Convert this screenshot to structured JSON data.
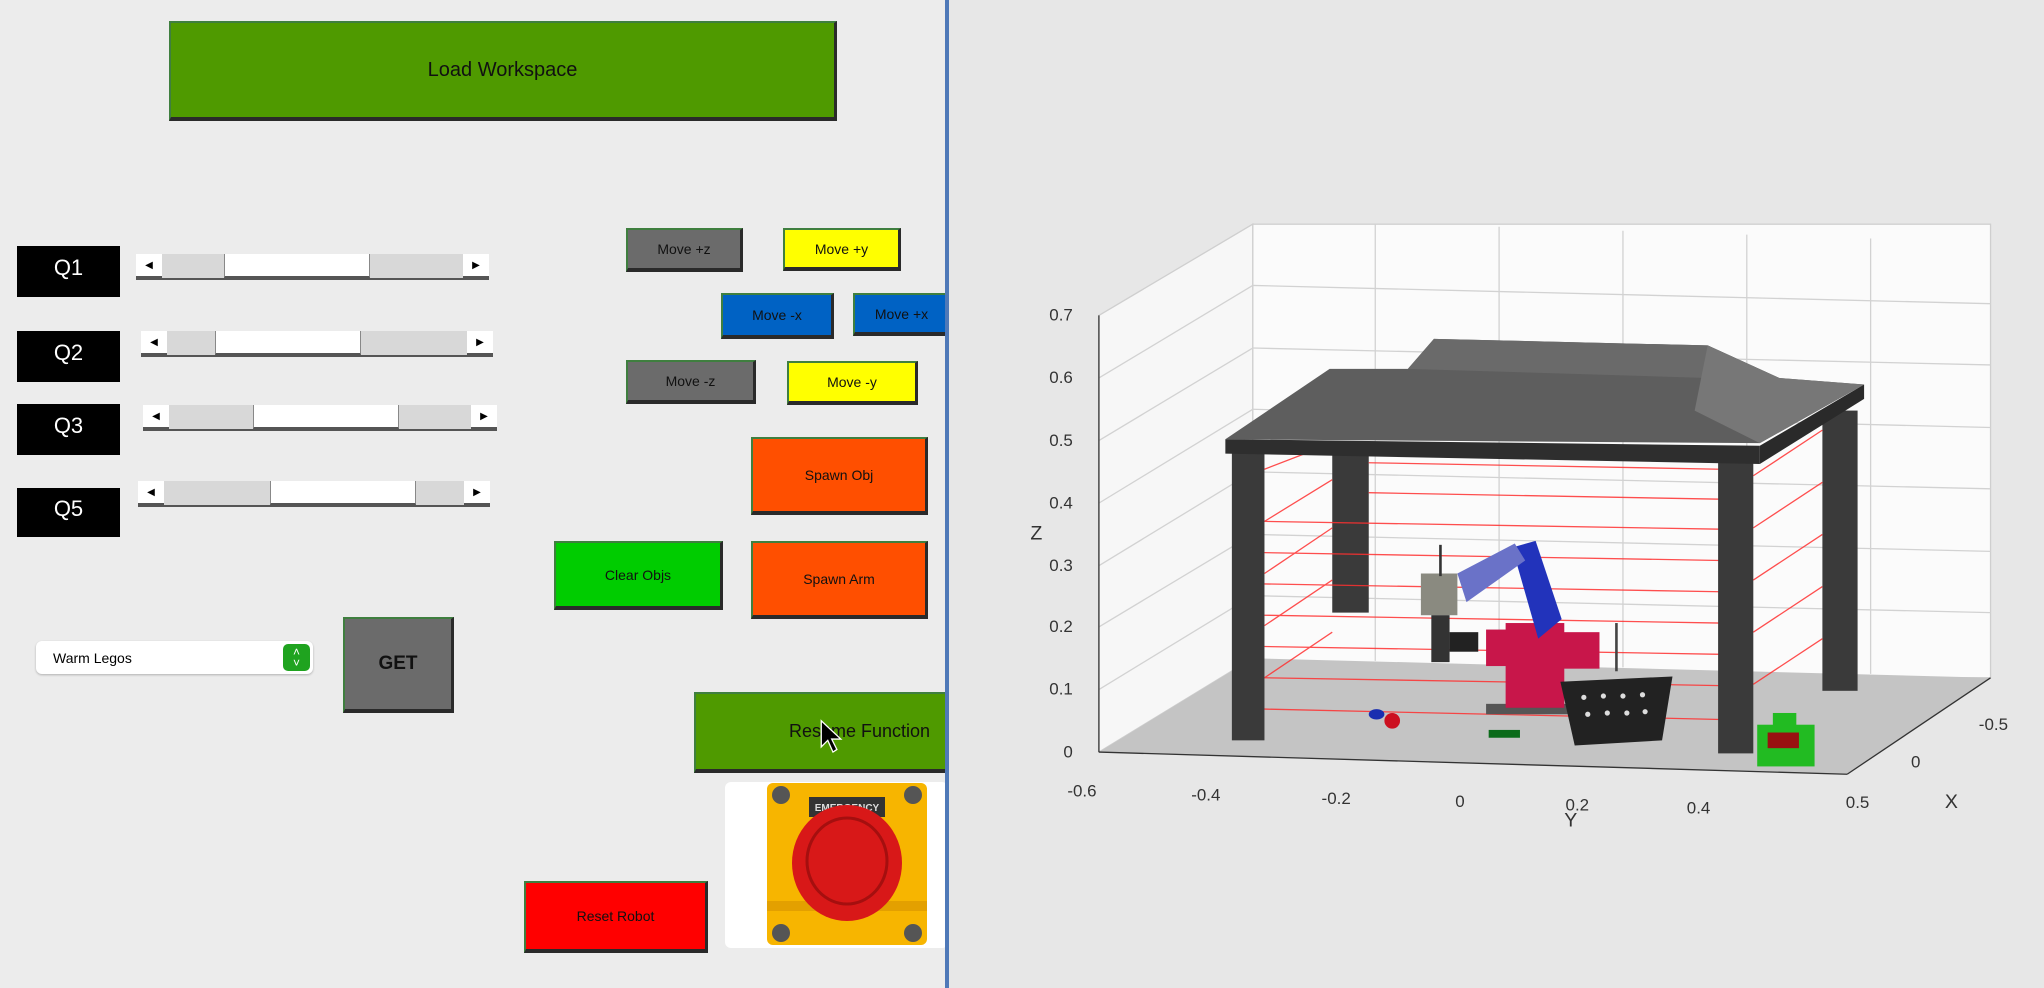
{
  "controls": {
    "load_workspace": "Load Workspace",
    "sliders": [
      {
        "label": "Q1",
        "value_fraction": 0.38
      },
      {
        "label": "Q2",
        "value_fraction": 0.35
      },
      {
        "label": "Q3",
        "value_fraction": 0.48
      },
      {
        "label": "Q5",
        "value_fraction": 0.57
      }
    ],
    "move_pos_z": "Move +z",
    "move_pos_y": "Move +y",
    "move_neg_x": "Move -x",
    "move_pos_x": "Move +x",
    "move_neg_z": "Move -z",
    "move_neg_y": "Move -y",
    "spawn_obj": "Spawn Obj",
    "clear_objs": "Clear Objs",
    "spawn_arm": "Spawn Arm",
    "dropdown_value": "Warm Legos",
    "get": "GET",
    "resume_function": "Resume Function",
    "emergency_label": "EMERGENCY",
    "reset_robot": "Reset Robot"
  },
  "colors": {
    "green_button": "#4f9a00",
    "gray_button": "#6b6b6b",
    "yellow_button": "#ffff00",
    "blue_button": "#0062c4",
    "orange_button": "#ff4f00",
    "bright_green_button": "#00cc00",
    "red_button": "#ff0000"
  },
  "plot": {
    "z_label": "Z",
    "y_label": "Y",
    "x_label": "X",
    "z_ticks": [
      "0",
      "0.1",
      "0.2",
      "0.3",
      "0.4",
      "0.5",
      "0.6",
      "0.7"
    ],
    "y_ticks": [
      "-0.6",
      "-0.4",
      "-0.2",
      "0",
      "0.2",
      "0.4",
      "0.5"
    ],
    "x_ticks": [
      "-0.5",
      "0",
      "0.5"
    ]
  }
}
